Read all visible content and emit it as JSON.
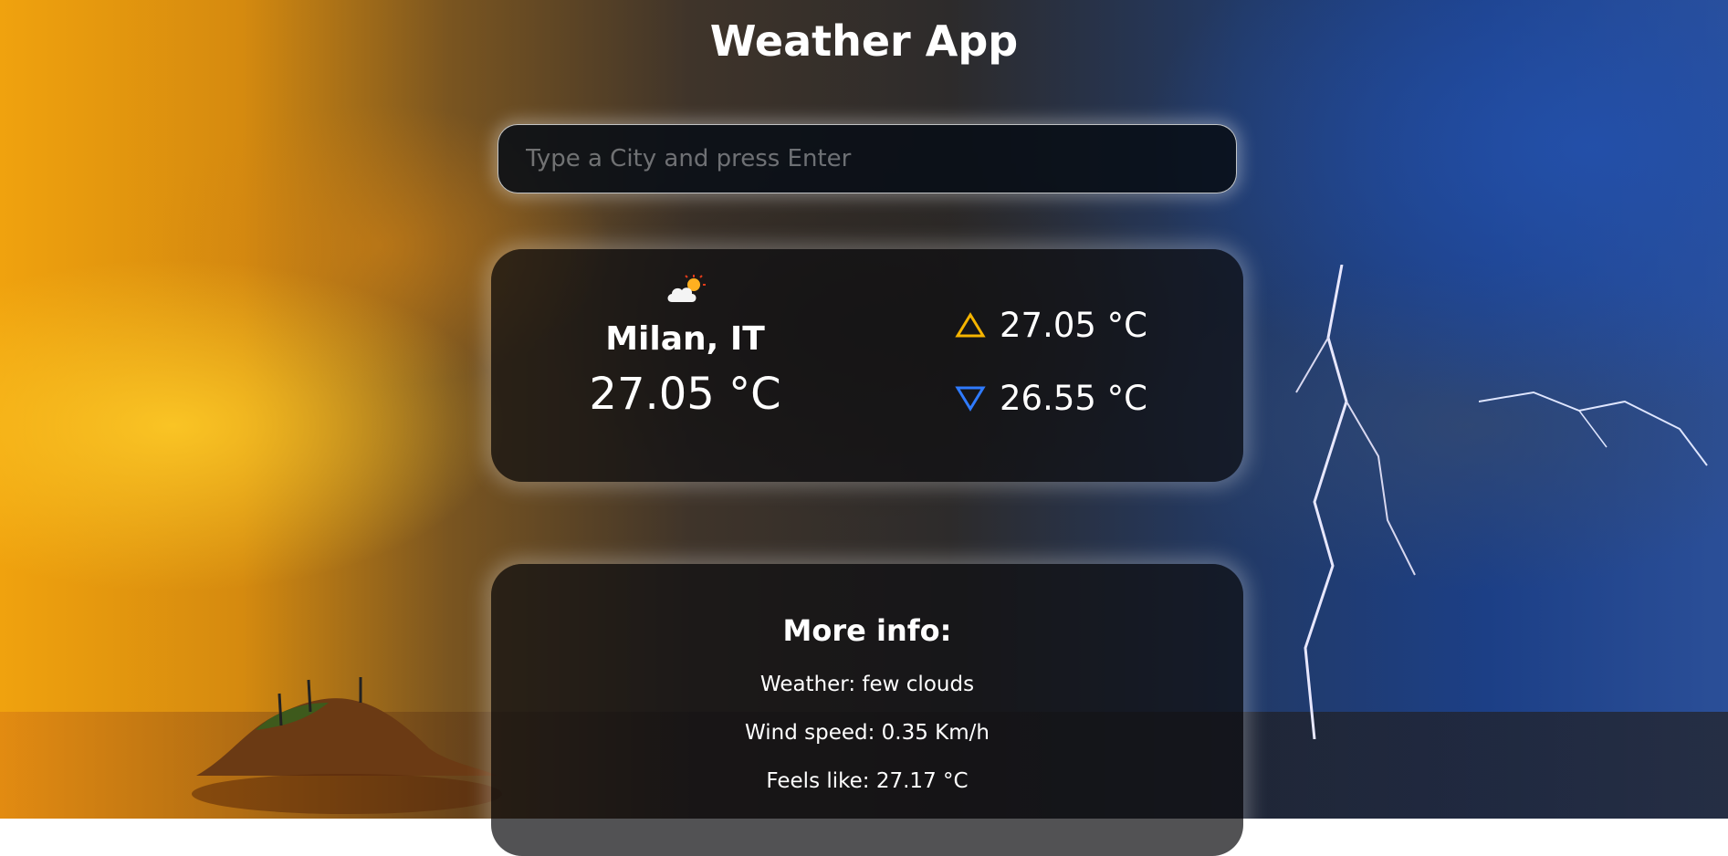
{
  "app": {
    "title": "Weather App"
  },
  "search": {
    "placeholder": "Type a City and press Enter",
    "value": ""
  },
  "current": {
    "icon": "cloud-sun-icon",
    "city": "Milan, IT",
    "temperature": "27.05 °C",
    "max": {
      "icon": "triangle-up-icon",
      "value": "27.05 °C",
      "color": "#f5b400"
    },
    "min": {
      "icon": "triangle-down-icon",
      "value": "26.55 °C",
      "color": "#2f7bff"
    }
  },
  "more_info": {
    "title": "More info:",
    "weather": "Weather: few clouds",
    "wind": "Wind speed: 0.35 Km/h",
    "feels_like": "Feels like: 27.17 °C"
  }
}
